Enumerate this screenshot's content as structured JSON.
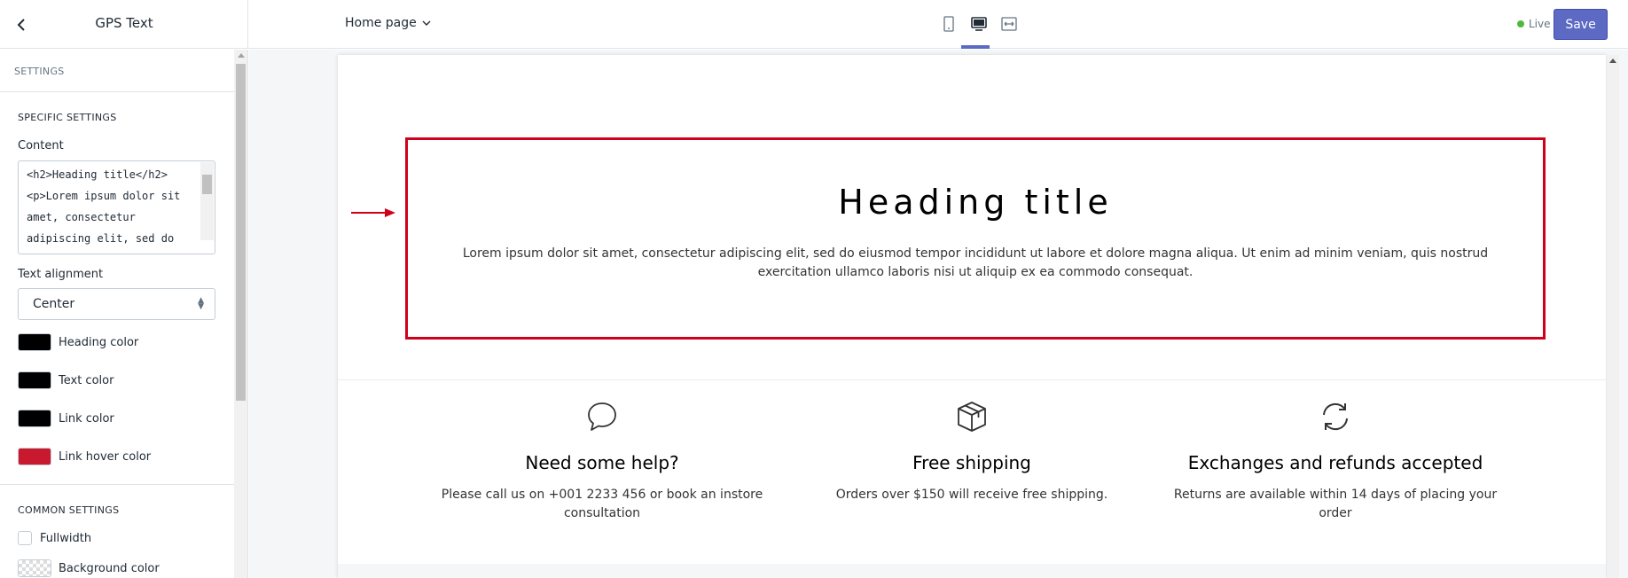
{
  "topbar": {
    "title": "GPS Text",
    "page_select": "Home page",
    "live_label": "Live",
    "save_label": "Save"
  },
  "sidebar": {
    "header": "SETTINGS",
    "specific_title": "SPECIFIC SETTINGS",
    "content_label": "Content",
    "content_value": "<h2>Heading title</h2>\n<p>Lorem ipsum dolor sit amet, consectetur adipiscing elit, sed do eiusmod tempor",
    "alignment_label": "Text alignment",
    "alignment_value": "Center",
    "colors": [
      {
        "label": "Heading color",
        "value": "#000000"
      },
      {
        "label": "Text color",
        "value": "#000000"
      },
      {
        "label": "Link color",
        "value": "#000000"
      },
      {
        "label": "Link hover color",
        "value": "#c8192e"
      }
    ],
    "common_title": "COMMON SETTINGS",
    "fullwidth_label": "Fullwidth",
    "background_label": "Background color"
  },
  "preview": {
    "heading": "Heading title",
    "paragraph": "Lorem ipsum dolor sit amet, consectetur adipiscing elit, sed do eiusmod tempor incididunt ut labore et dolore magna aliqua. Ut enim ad minim veniam, quis nostrud exercitation ullamco laboris nisi ut aliquip ex ea commodo consequat.",
    "features": [
      {
        "icon": "chat-bubble-icon",
        "title": "Need some help?",
        "text": "Please call us on +001 2233 456 or book an instore consultation"
      },
      {
        "icon": "package-box-icon",
        "title": "Free shipping",
        "text": "Orders over $150 will receive free shipping."
      },
      {
        "icon": "refresh-icon",
        "title": "Exchanges and refunds accepted",
        "text": "Returns are available within 14 days of placing your order"
      }
    ]
  },
  "colors": {
    "accent": "#5c6ac4",
    "highlight_border": "#d0021b",
    "live_dot": "#50b83c"
  }
}
